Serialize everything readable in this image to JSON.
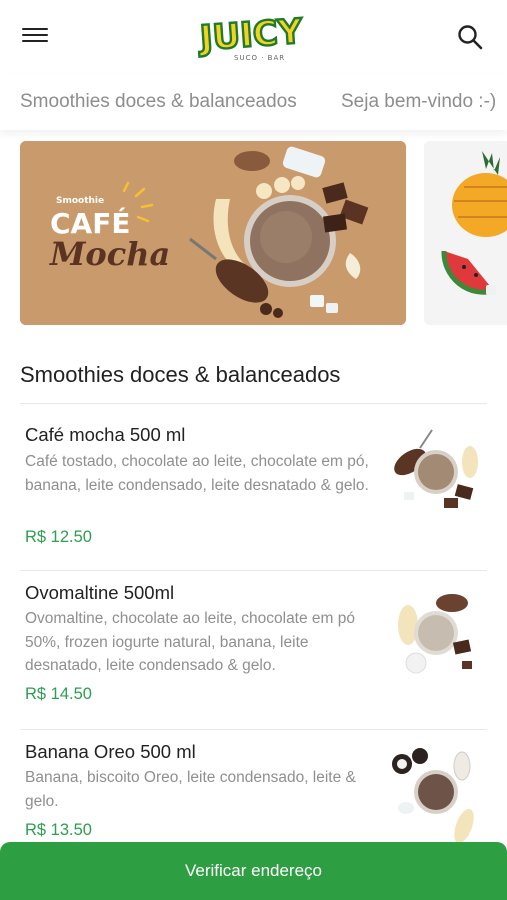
{
  "header": {
    "logo_text": "JUICY",
    "logo_subtitle": "SUCO · BAR"
  },
  "tabs": [
    {
      "label": "Smoothies doces & balanceados"
    },
    {
      "label": "Seja bem-vindo :-)"
    }
  ],
  "banners": [
    {
      "kicker": "Smoothie",
      "title_line1": "CAFÉ",
      "title_line2": "Mocha"
    },
    {}
  ],
  "section": {
    "title": "Smoothies doces & balanceados"
  },
  "products": [
    {
      "name": "Café mocha 500 ml",
      "description": "Café tostado, chocolate ao leite, chocolate em pó, banana, leite condensado, leite desnatado & gelo.",
      "price": "R$ 12.50"
    },
    {
      "name": "Ovomaltine 500ml",
      "description": "Ovomaltine, chocolate ao leite, chocolate em pó 50%, frozen iogurte natural, banana, leite desnatado, leite condensado & gelo.",
      "price": "R$ 14.50"
    },
    {
      "name": "Banana Oreo 500 ml",
      "description": "Banana, biscoito Oreo, leite condensado, leite & gelo.",
      "price": "R$ 13.50"
    }
  ],
  "cta": {
    "label": "Verificar endereço"
  },
  "colors": {
    "accent_green": "#2e9e43",
    "price_green": "#2e9e4f",
    "banner_brown": "#c99a6b"
  }
}
